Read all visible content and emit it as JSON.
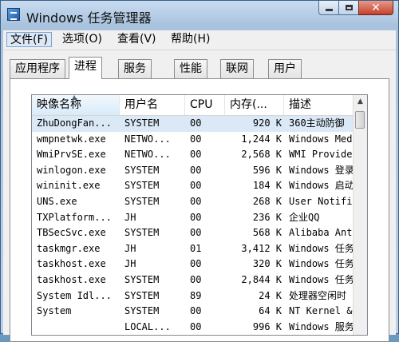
{
  "window": {
    "title": "Windows 任务管理器"
  },
  "menu": {
    "items": [
      "文件(F)",
      "选项(O)",
      "查看(V)",
      "帮助(H)"
    ]
  },
  "tabs": [
    "应用程序",
    "进程",
    "服务",
    "性能",
    "联网",
    "用户"
  ],
  "selected_tab": "进程",
  "table": {
    "headers": [
      "映像名称",
      "用户名",
      "CPU",
      "内存(...",
      "描述"
    ],
    "sorted_column": "映像名称",
    "rows": [
      {
        "name": "ZhuDongFan...",
        "user": "SYSTEM",
        "cpu": "00",
        "mem": "920 K",
        "desc": "360主动防御"
      },
      {
        "name": "wmpnetwk.exe",
        "user": "NETWO...",
        "cpu": "00",
        "mem": "1,244 K",
        "desc": "Windows Media"
      },
      {
        "name": "WmiPrvSE.exe",
        "user": "NETWO...",
        "cpu": "00",
        "mem": "2,568 K",
        "desc": "WMI Provider"
      },
      {
        "name": "winlogon.exe",
        "user": "SYSTEM",
        "cpu": "00",
        "mem": "596 K",
        "desc": "Windows 登录"
      },
      {
        "name": "wininit.exe",
        "user": "SYSTEM",
        "cpu": "00",
        "mem": "184 K",
        "desc": "Windows 启动"
      },
      {
        "name": "UNS.exe",
        "user": "SYSTEM",
        "cpu": "00",
        "mem": "268 K",
        "desc": "User Notific"
      },
      {
        "name": "TXPlatform...",
        "user": "JH",
        "cpu": "00",
        "mem": "236 K",
        "desc": "企业QQ"
      },
      {
        "name": "TBSecSvc.exe",
        "user": "SYSTEM",
        "cpu": "00",
        "mem": "568 K",
        "desc": "Alibaba Anti"
      },
      {
        "name": "taskmgr.exe",
        "user": "JH",
        "cpu": "01",
        "mem": "3,412 K",
        "desc": "Windows 任务"
      },
      {
        "name": "taskhost.exe",
        "user": "JH",
        "cpu": "00",
        "mem": "320 K",
        "desc": "Windows 任务"
      },
      {
        "name": "taskhost.exe",
        "user": "SYSTEM",
        "cpu": "00",
        "mem": "2,844 K",
        "desc": "Windows 任务"
      },
      {
        "name": "System Idl...",
        "user": "SYSTEM",
        "cpu": "89",
        "mem": "24 K",
        "desc": "处理器空闲时"
      },
      {
        "name": "System",
        "user": "SYSTEM",
        "cpu": "00",
        "mem": "64 K",
        "desc": "NT Kernel &"
      },
      {
        "name": "",
        "user": "LOCAL...",
        "cpu": "00",
        "mem": "996 K",
        "desc": "Windows 服务"
      }
    ]
  }
}
